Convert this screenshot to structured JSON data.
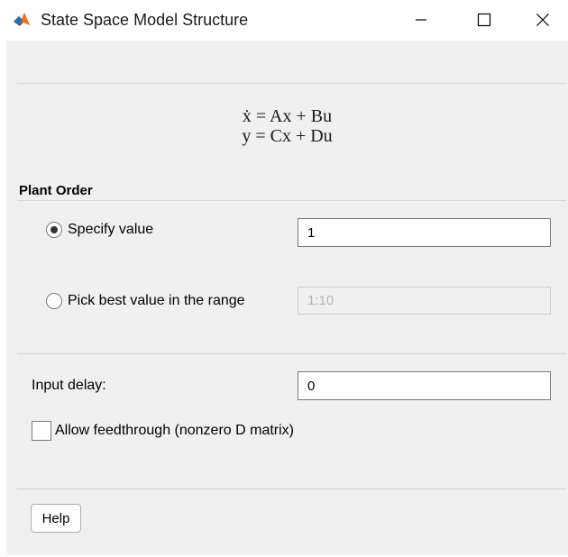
{
  "window": {
    "title": "State Space Model Structure",
    "icon": "matlab-icon"
  },
  "equation": {
    "line1": "ẋ = Ax + Bu",
    "line2": "y = Cx + Du"
  },
  "plant_order": {
    "section_title": "Plant Order",
    "specify_label": "Specify value",
    "specify_selected": true,
    "specify_value": "1",
    "range_label": "Pick best value in the range",
    "range_selected": false,
    "range_value": "1:10",
    "range_enabled": false
  },
  "input_delay": {
    "label": "Input delay:",
    "value": "0"
  },
  "feedthrough": {
    "label": "Allow feedthrough (nonzero D matrix)",
    "checked": false
  },
  "footer": {
    "help_label": "Help"
  }
}
